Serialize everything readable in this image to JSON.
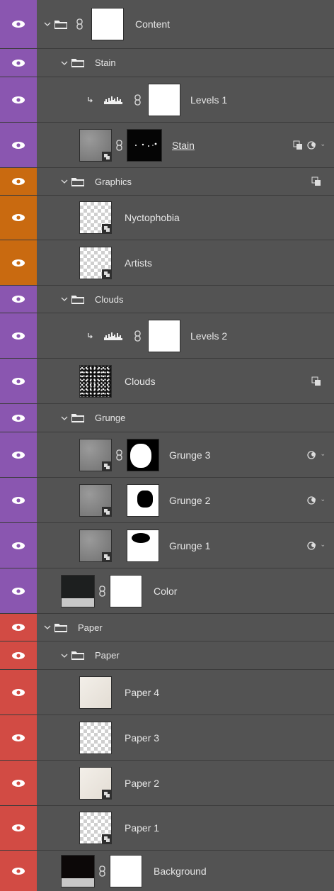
{
  "colors": {
    "purple": "#8a56b0",
    "orange": "#c96a10",
    "red": "#d24b44",
    "panel_bg": "#535353"
  },
  "layers": [
    {
      "id": "content",
      "label": "Content",
      "kind": "group",
      "color": "purple",
      "expanded": true
    },
    {
      "id": "stain-group",
      "label": "Stain",
      "kind": "group",
      "color": "purple",
      "expanded": true
    },
    {
      "id": "levels-1",
      "label": "Levels 1",
      "kind": "adjustment",
      "color": "purple",
      "clipped": true
    },
    {
      "id": "stain",
      "label": "Stain",
      "kind": "smart-masked",
      "color": "purple"
    },
    {
      "id": "graphics-group",
      "label": "Graphics",
      "kind": "group",
      "color": "orange",
      "expanded": true
    },
    {
      "id": "nyctophobia",
      "label": "Nyctophobia",
      "kind": "smart",
      "color": "orange"
    },
    {
      "id": "artists",
      "label": "Artists",
      "kind": "smart",
      "color": "orange"
    },
    {
      "id": "clouds-group",
      "label": "Clouds",
      "kind": "group",
      "color": "purple",
      "expanded": true
    },
    {
      "id": "levels-2",
      "label": "Levels 2",
      "kind": "adjustment",
      "color": "purple",
      "clipped": true
    },
    {
      "id": "clouds",
      "label": "Clouds",
      "kind": "noise",
      "color": "purple"
    },
    {
      "id": "grunge-group",
      "label": "Grunge",
      "kind": "group",
      "color": "purple",
      "expanded": true
    },
    {
      "id": "grunge-3",
      "label": "Grunge 3",
      "kind": "smart-masked",
      "color": "purple"
    },
    {
      "id": "grunge-2",
      "label": "Grunge 2",
      "kind": "smart-masked",
      "color": "purple"
    },
    {
      "id": "grunge-1",
      "label": "Grunge 1",
      "kind": "smart-masked",
      "color": "purple"
    },
    {
      "id": "color",
      "label": "Color",
      "kind": "fill",
      "color": "purple"
    },
    {
      "id": "paper-group-outer",
      "label": "Paper",
      "kind": "group",
      "color": "red",
      "expanded": true
    },
    {
      "id": "paper-group-inner",
      "label": "Paper",
      "kind": "group",
      "color": "red",
      "expanded": true
    },
    {
      "id": "paper-4",
      "label": "Paper 4",
      "kind": "paper",
      "color": "red"
    },
    {
      "id": "paper-3",
      "label": "Paper 3",
      "kind": "paper-check",
      "color": "red"
    },
    {
      "id": "paper-2",
      "label": "Paper 2",
      "kind": "paper-smart",
      "color": "red"
    },
    {
      "id": "paper-1",
      "label": "Paper 1",
      "kind": "paper-smart",
      "color": "red"
    },
    {
      "id": "background",
      "label": "Background",
      "kind": "fill-bg",
      "color": "red"
    }
  ]
}
